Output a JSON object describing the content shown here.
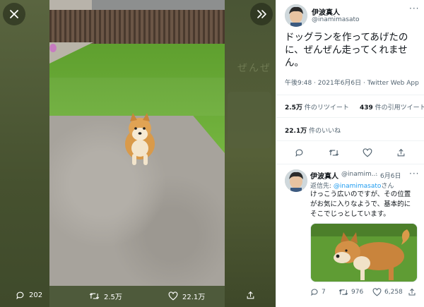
{
  "viewer": {
    "ghost_caption": "ぜんぜ",
    "reply_count": "202",
    "retweet_count": "2.5万",
    "like_count": "22.1万"
  },
  "tweet": {
    "author_name": "伊波真人",
    "author_handle": "@inamimasato",
    "text": "ドッグランを作ってあげたのに、ぜんぜん走ってくれません。",
    "timestamp": "午後9:48 · 2021年6月6日 · Twitter Web App",
    "retweets_value": "2.5万",
    "retweets_label": "件のリツイート",
    "quotes_value": "439",
    "quotes_label": "件の引用ツイート",
    "likes_value": "22.1万",
    "likes_label": "件のいいね"
  },
  "reply": {
    "author_name": "伊波真人",
    "author_handle": "@inamim...",
    "date": "6月6日",
    "replying_to_prefix": "返信先: ",
    "replying_to_handle": "@inamimasato",
    "replying_to_suffix": "さん",
    "text_line1": "けっこう広いのですが、その位置",
    "text_line2": "がお気に入りなようで、基本的に",
    "text_line3": "そこでじっとしています。",
    "reply_count": "7",
    "retweet_count": "976",
    "like_count": "6,258"
  },
  "icons": [
    "close-icon",
    "chevron-right-icon",
    "reply-icon",
    "retweet-icon",
    "like-icon",
    "share-icon",
    "more-icon"
  ],
  "colors": {
    "link": "#1d9bf0",
    "text": "#0f1419",
    "secondary": "#536471",
    "viewer_bg": "#4e5a3b"
  }
}
